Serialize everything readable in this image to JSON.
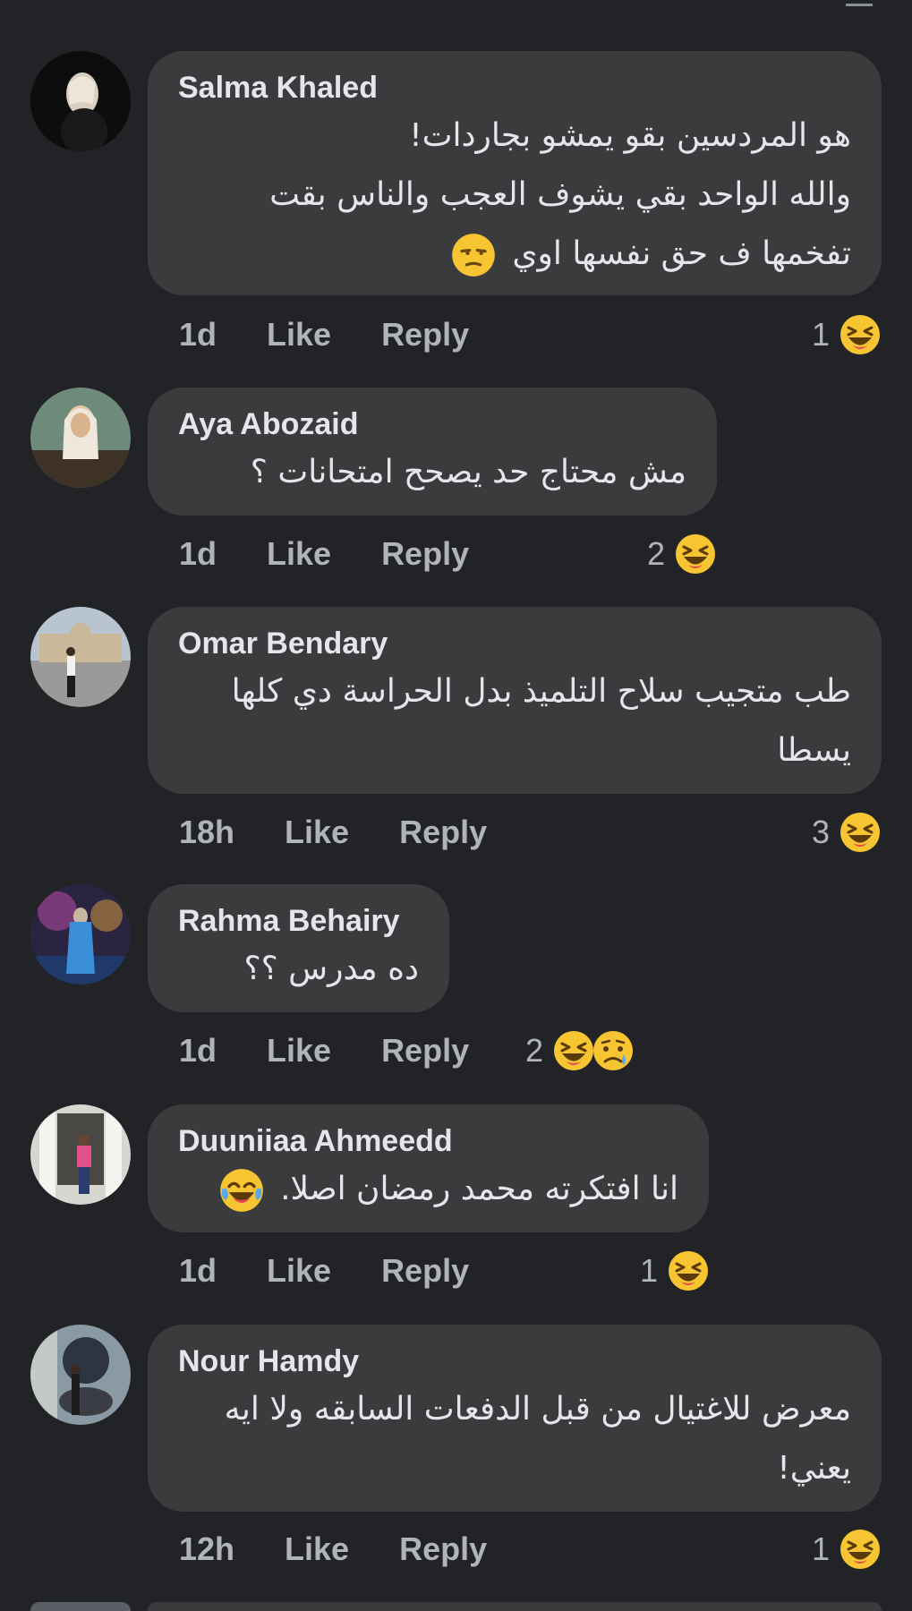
{
  "comments": [
    {
      "author": "Salma Khaled",
      "lines": [
        "هو المردسين بقو يمشو بجاردات!",
        "والله الواحد بقي يشوف العجب والناس بقت",
        "تفخمها ف حق نفسها اوي"
      ],
      "line_emoji": "unamused-face-icon",
      "time": "1d",
      "like": "Like",
      "reply": "Reply",
      "reaction_count": "1",
      "reactions": [
        "laughing-face-icon"
      ]
    },
    {
      "author": "Aya Abozaid",
      "lines": [
        "مش محتاج حد يصحح امتحانات ؟"
      ],
      "time": "1d",
      "like": "Like",
      "reply": "Reply",
      "reaction_count": "2",
      "reactions": [
        "laughing-face-icon"
      ]
    },
    {
      "author": "Omar Bendary",
      "lines": [
        "طب متجيب سلاح التلميذ بدل الحراسة دي كلها",
        "يسطا"
      ],
      "time": "18h",
      "like": "Like",
      "reply": "Reply",
      "reaction_count": "3",
      "reactions": [
        "laughing-face-icon"
      ]
    },
    {
      "author": "Rahma Behairy",
      "lines": [
        "ده مدرس ؟؟"
      ],
      "time": "1d",
      "like": "Like",
      "reply": "Reply",
      "reaction_count": "2",
      "reactions": [
        "laughing-face-icon",
        "sad-face-icon"
      ]
    },
    {
      "author": "Duuniiaa Ahmeedd",
      "lines": [
        "انا افتكرته محمد رمضان اصلا."
      ],
      "line_emoji": "tears-of-joy-face-icon",
      "time": "1d",
      "like": "Like",
      "reply": "Reply",
      "reaction_count": "1",
      "reactions": [
        "laughing-face-icon"
      ]
    },
    {
      "author": "Nour Hamdy",
      "lines": [
        "معرض للاغتيال من قبل الدفعات السابقه ولا ايه",
        "يعني!"
      ],
      "time": "12h",
      "like": "Like",
      "reply": "Reply",
      "reaction_count": "1",
      "reactions": [
        "laughing-face-icon"
      ]
    }
  ],
  "colors": {
    "background": "#222326",
    "bubble": "#3a3b3c",
    "primary_text": "#e4e6eb",
    "secondary_text": "#b0b3b8",
    "emoji_yellow": "#f7c531"
  }
}
